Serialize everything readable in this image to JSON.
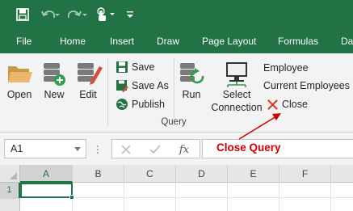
{
  "quick_access": {
    "icons": [
      "save-icon",
      "undo-icon",
      "redo-icon",
      "touch-mode-icon",
      "customize-qat-icon"
    ]
  },
  "menu": {
    "tabs": [
      "File",
      "Home",
      "Insert",
      "Draw",
      "Page Layout",
      "Formulas",
      "Dat"
    ]
  },
  "ribbon": {
    "open": "Open",
    "new": "New",
    "edit": "Edit",
    "save": "Save",
    "save_as": "Save As",
    "publish": "Publish",
    "run": "Run",
    "select_line1": "Select",
    "select_line2": "Connection",
    "employee": "Employee",
    "current_employees": "Current Employees",
    "close": "Close",
    "group_label": "Query"
  },
  "formula_bar": {
    "name_box": "A1",
    "fx_label": "fx",
    "value": ""
  },
  "annotation": {
    "text": "Close Query",
    "color": "#d00000"
  },
  "grid": {
    "columns": [
      "A",
      "B",
      "C",
      "D",
      "E",
      "F"
    ],
    "rows": [
      "1"
    ],
    "selected_cell": "A1"
  },
  "colors": {
    "accent": "#217346",
    "ribbon_bg": "#f3f3f3"
  }
}
